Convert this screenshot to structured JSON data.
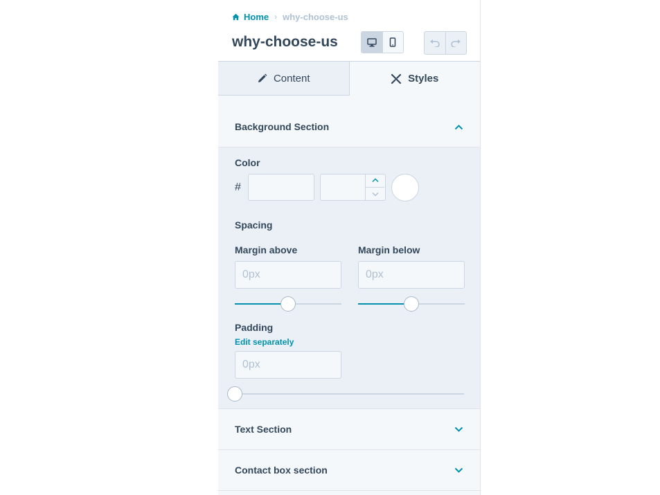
{
  "breadcrumb": {
    "home": "Home",
    "separator": "›",
    "current": "why-choose-us"
  },
  "page_title": "why-choose-us",
  "toolbar": {
    "desktop_icon": "desktop-icon",
    "mobile_icon": "mobile-icon",
    "undo_icon": "undo-icon",
    "redo_icon": "redo-icon",
    "active_device": "desktop"
  },
  "tabs": [
    {
      "label": "Content",
      "icon": "pencil-icon",
      "active": false
    },
    {
      "label": "Styles",
      "icon": "brush-icon",
      "active": true
    }
  ],
  "background_section": {
    "title": "Background Section",
    "expanded": true,
    "color": {
      "label": "Color",
      "hash": "#",
      "hex_value": "",
      "opacity_value": ""
    },
    "spacing": {
      "label": "Spacing",
      "margin_above": {
        "label": "Margin above",
        "placeholder": "0px",
        "slider_fraction": 0.5
      },
      "margin_below": {
        "label": "Margin below",
        "placeholder": "0px",
        "slider_fraction": 0.5
      }
    },
    "padding": {
      "label": "Padding",
      "edit_link": "Edit separately",
      "placeholder": "0px",
      "slider_fraction": 0.0
    }
  },
  "collapsed_sections": [
    {
      "title": "Text Section"
    },
    {
      "title": "Contact box section"
    }
  ],
  "colors": {
    "accent": "#0091ae",
    "text": "#33475b",
    "muted": "#b0c1d4",
    "border": "#cbd6e2"
  }
}
